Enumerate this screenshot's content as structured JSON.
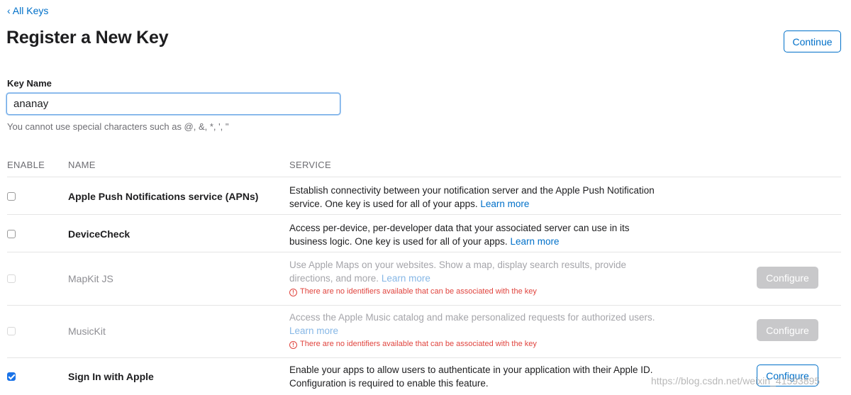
{
  "nav": {
    "back_label": "‹ All Keys"
  },
  "header": {
    "title": "Register a New Key",
    "continue_label": "Continue"
  },
  "form": {
    "label": "Key Name",
    "value": "ananay",
    "hint": "You cannot use special characters such as @, &, *, ', \""
  },
  "table": {
    "headers": {
      "enable": "ENABLE",
      "name": "NAME",
      "service": "SERVICE"
    },
    "rows": [
      {
        "name": "Apple Push Notifications service (APNs)",
        "desc": "Establish connectivity between your notification server and the Apple Push Notification service. One key is used for all of your apps.",
        "learn": "Learn more",
        "enabled": false
      },
      {
        "name": "DeviceCheck",
        "desc": "Access per-device, per-developer data that your associated server can use in its business logic. One key is used for all of your apps.",
        "learn": "Learn more",
        "enabled": false
      },
      {
        "name": "MapKit JS",
        "desc": "Use Apple Maps on your websites. Show a map, display search results, provide directions, and more.",
        "learn": "Learn more",
        "warning": "There are no identifiers available that can be associated with the key",
        "configure": "Configure",
        "enabled": false
      },
      {
        "name": "MusicKit",
        "desc": "Access the Apple Music catalog and make personalized requests for authorized users.",
        "learn": "Learn more",
        "warning": "There are no identifiers available that can be associated with the key",
        "configure": "Configure",
        "enabled": false
      },
      {
        "name": "Sign In with Apple",
        "desc": "Enable your apps to allow users to authenticate in your application with their Apple ID. Configuration is required to enable this feature.",
        "configure": "Configure",
        "enabled": true
      }
    ]
  },
  "watermark": "https://blog.csdn.net/weixin_41593895",
  "colors": {
    "accent": "#0070c9",
    "warning": "#e0443e",
    "checkbox_checked": "#1a73e8"
  }
}
